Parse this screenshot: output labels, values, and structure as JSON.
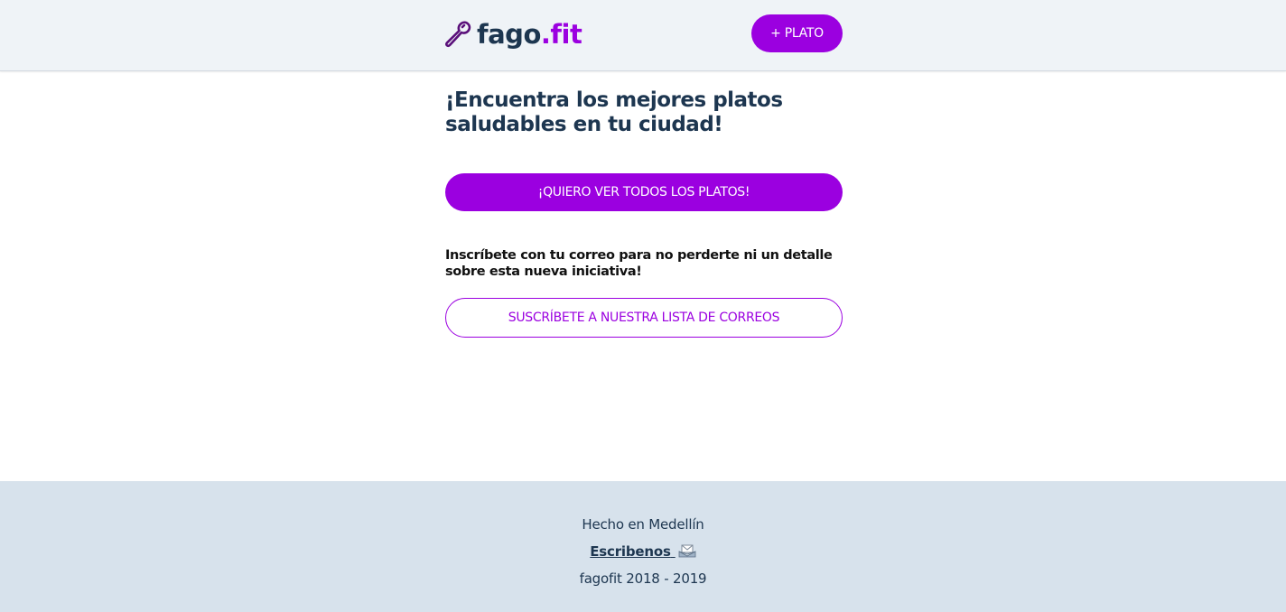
{
  "header": {
    "logo_main": "fago",
    "logo_accent": ".fit",
    "logo_icon": "spoon-icon",
    "add_plate_label": "+ PLATO"
  },
  "main": {
    "headline": "¡Encuentra los mejores platos saludables en tu ciudad!",
    "cta_label": "¡QUIERO VER TODOS LOS PLATOS!",
    "subscribe_text": "Inscríbete con tu correo para no perderte ni un detalle sobre esta nueva iniciativa!",
    "subscribe_label": "SUSCRÍBETE A NUESTRA LISTA DE CORREOS"
  },
  "footer": {
    "made_in": "Hecho en Medellín",
    "contact_label": "Escribenos",
    "contact_icon": "envelope-icon",
    "copyright": "fagofit 2018 - 2019"
  },
  "colors": {
    "accent": "#9b00e0",
    "navy": "#1d3650",
    "header_bg": "#eff3f7",
    "footer_bg": "#d7e2ec"
  }
}
